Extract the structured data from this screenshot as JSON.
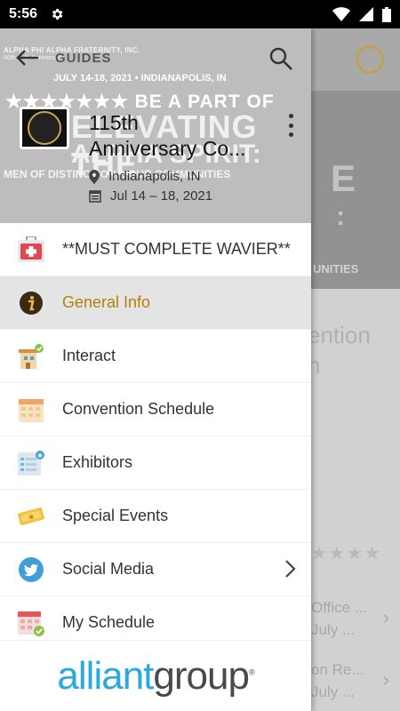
{
  "status_bar": {
    "time": "5:56"
  },
  "drawer": {
    "header": {
      "back_label": "GUIDES",
      "banner_lines": [
        "ALPHA PHI ALPHA FRATERNITY, INC.",
        "96th ... th Anniversary",
        "JULY 14-18, 2021 • INDIANAPOLIS, IN",
        "★★★★★★★ BE A PART OF",
        "ELEVATING THE",
        "ALPHA SPIRIT:",
        "MEN OF DISTINCTION... OUR COMMUNITIES"
      ],
      "event_title_line1": "115th",
      "event_title_line2": "Anniversary Co...",
      "location": "Indianapolis, IN",
      "dates": "Jul 14 – 18, 2021"
    },
    "menu": [
      {
        "label": "**MUST COMPLETE WAVIER**",
        "icon": "first-aid-kit-icon"
      },
      {
        "label": "General Info",
        "icon": "info-icon",
        "active": true
      },
      {
        "label": "Interact",
        "icon": "interact-icon"
      },
      {
        "label": "Convention Schedule",
        "icon": "calendar-icon"
      },
      {
        "label": "Exhibitors",
        "icon": "exhibitors-icon"
      },
      {
        "label": "Special Events",
        "icon": "ticket-icon"
      },
      {
        "label": "Social Media",
        "icon": "twitter-icon",
        "has_chevron": true
      },
      {
        "label": "My Schedule",
        "icon": "my-schedule-icon"
      }
    ],
    "sponsor": {
      "part1": "alliant",
      "part2": "group",
      "mark": "®"
    }
  },
  "background": {
    "banner_text_1": "E",
    "banner_text_2": ":",
    "banner_text_3": "UNITIES",
    "heading_line1": "ention",
    "heading_line2": "n",
    "row1_line1": "Office ...",
    "row1_line2": "July ...",
    "row2_line1": "on Re...",
    "row2_line2": "July ..."
  },
  "colors": {
    "accent": "#b5800c",
    "active_bg": "#e4e4e4",
    "sponsor_blue": "#2aa9e0",
    "sponsor_gray": "#4a4a4a"
  }
}
